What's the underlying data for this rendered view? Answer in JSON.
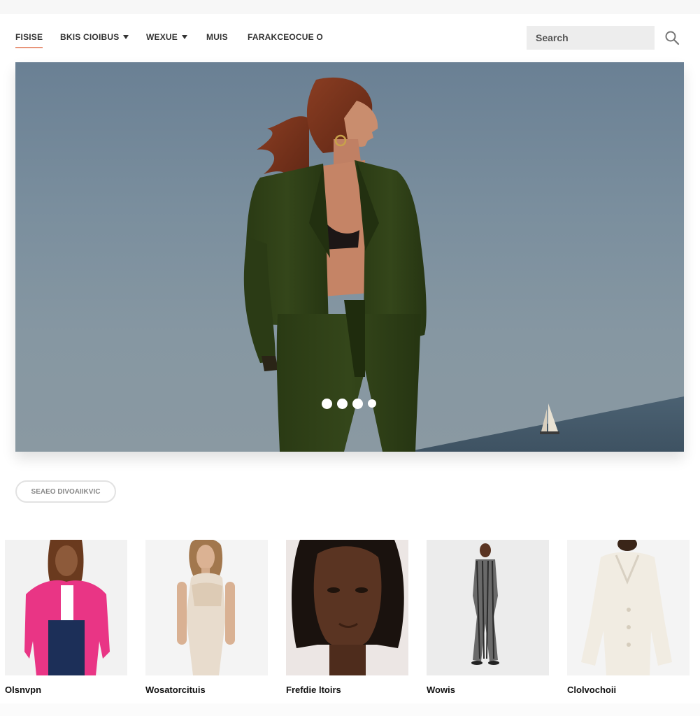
{
  "nav": {
    "items": [
      {
        "label": "FISISE",
        "active": true,
        "dropdown": false
      },
      {
        "label": "BKIS CIOIBUS",
        "active": false,
        "dropdown": true
      },
      {
        "label": "WEXUE",
        "active": false,
        "dropdown": true
      },
      {
        "label": "MUIS",
        "active": false,
        "dropdown": false
      },
      {
        "label": "FARAKCEOCUE O",
        "active": false,
        "dropdown": false
      }
    ],
    "search": {
      "placeholder": "Search",
      "value": "",
      "icon": "search-icon"
    }
  },
  "hero": {
    "carousel": {
      "slide_count": 4,
      "active_index": 0
    }
  },
  "filter_button": {
    "label": "SEAEO DIVOAIIKVIC"
  },
  "products": [
    {
      "name": "Olsnvpn",
      "accent": "#e93585"
    },
    {
      "name": "Wosatorcituis",
      "accent": "#e8dccd"
    },
    {
      "name": "Frefdie ltoirs",
      "accent": "#5a3422"
    },
    {
      "name": "Wowis",
      "accent": "#6a6a6a"
    },
    {
      "name": "Clolvochoii",
      "accent": "#f1ece2"
    }
  ],
  "colors": {
    "accent_underline": "#e8957a",
    "search_bg": "#ededed",
    "hero_sky": "#7b8f9e",
    "suit_green": "#2f3f18"
  }
}
